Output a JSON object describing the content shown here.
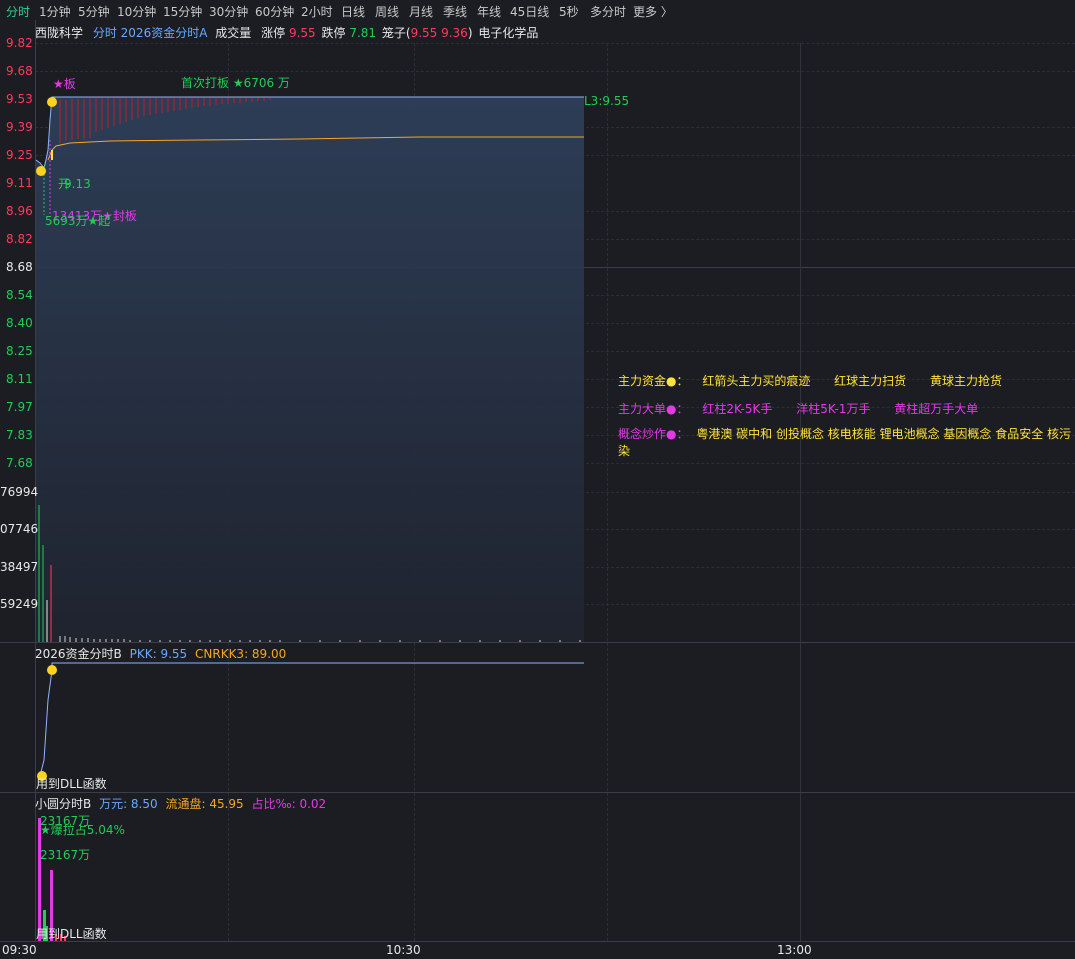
{
  "tabs": [
    "分时",
    "1分钟",
    "5分钟",
    "10分钟",
    "15分钟",
    "30分钟",
    "60分钟",
    "2小时",
    "日线",
    "周线",
    "月线",
    "季线",
    "年线",
    "45日线",
    "5秒",
    "多分时",
    "更多 〉"
  ],
  "header": {
    "stock_name": "西陇科学",
    "indicator": "分时 2026资金分时A",
    "volume_label": "成交量",
    "limit_up_label": "涨停",
    "limit_up_value": "9.55",
    "limit_down_label": "跌停",
    "limit_down_value": "7.81",
    "cage_label": "笼子(",
    "cage_value": "9.55 9.36",
    "cage_close": ")",
    "sector": "电子化学品"
  },
  "price_axis": {
    "upper": [
      "9.82",
      "9.68",
      "9.53",
      "9.39",
      "9.25",
      "9.11",
      "8.96",
      "8.82"
    ],
    "base": "8.68",
    "lower": [
      "8.54",
      "8.40",
      "8.25",
      "8.11",
      "7.97",
      "7.83",
      "7.68"
    ]
  },
  "volume_axis": [
    "76994",
    "07746",
    "38497",
    "59249"
  ],
  "annotations": {
    "star_board": "★板",
    "first_hit": "首次打板 ★6706 万",
    "price_label_right": "L3:9.55",
    "open_label": "开",
    "price_913": "9.13",
    "seal_amount": "13413万★封板",
    "start_amount": "5693万★起"
  },
  "legend": {
    "main_funds_title": "主力资金●：",
    "main_funds_items": [
      "红箭头主力买的痕迹",
      "红球主力扫货",
      "黄球主力抢货"
    ],
    "big_orders_title": "主力大单●：",
    "big_orders_items": [
      "红柱2K-5K手",
      "洋柱5K-1万手",
      "黄柱超万手大单"
    ],
    "concepts_title": "概念炒作●：",
    "concepts_text": "粤港澳 碳中和 创投概念 核电核能 锂电池概念 基因概念 食品安全 核污染"
  },
  "panel_b": {
    "title": "2026资金分时B",
    "pkk_label": "PKK: 9.55",
    "cnrkk_label": "CNRKK3: 89.00",
    "dll_label": "用到DLL函数"
  },
  "panel_c": {
    "title": "小圆分时B",
    "wan_label": "万元: 8.50",
    "float_label": "流通盘: 45.95",
    "ratio_label": "占比‰: 0.02",
    "amount_top": "23167万",
    "pull_label": "★爆拉占5.04%",
    "amount_2": "23167万",
    "dll_label": "用到DLL函数"
  },
  "time_axis": [
    "09:30",
    "10:30",
    "13:00"
  ],
  "colors": {
    "up": "#ff3b5a",
    "down": "#22cc55",
    "price_line": "#6aa8ff",
    "avg_line": "#f5a623",
    "fill_top": "#2b3a52"
  }
}
